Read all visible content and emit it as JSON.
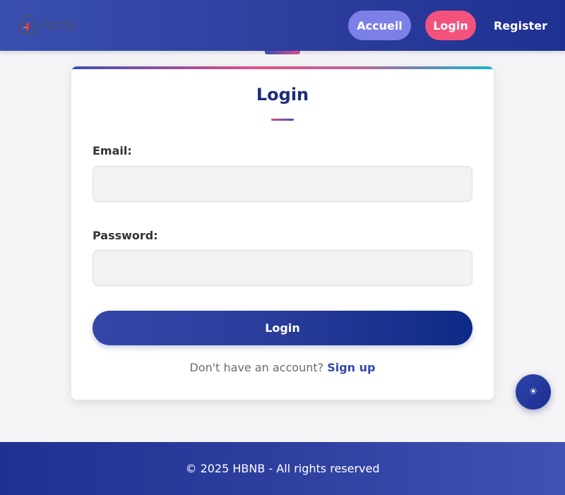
{
  "header": {
    "logo_text": "hbnb",
    "logo_icon": "airbnb-logo-icon",
    "nav": {
      "accueil": "Accueil",
      "login": "Login",
      "register": "Register"
    }
  },
  "form": {
    "title": "Login",
    "email_label": "Email:",
    "email_value": "",
    "password_label": "Password:",
    "password_value": "",
    "submit_label": "Login",
    "signup_prompt": "Don't have an account?",
    "signup_link": "Sign up"
  },
  "theme_toggle": {
    "icon": "sun-icon",
    "glyph": "☀"
  },
  "footer": {
    "text": "© 2025 HBNB - All rights reserved"
  },
  "colors": {
    "accent_primary": "#2e3f9e",
    "accent_pink": "#f3527c",
    "accent_lavender": "#7d7fe8",
    "title": "#1d2d7a"
  }
}
